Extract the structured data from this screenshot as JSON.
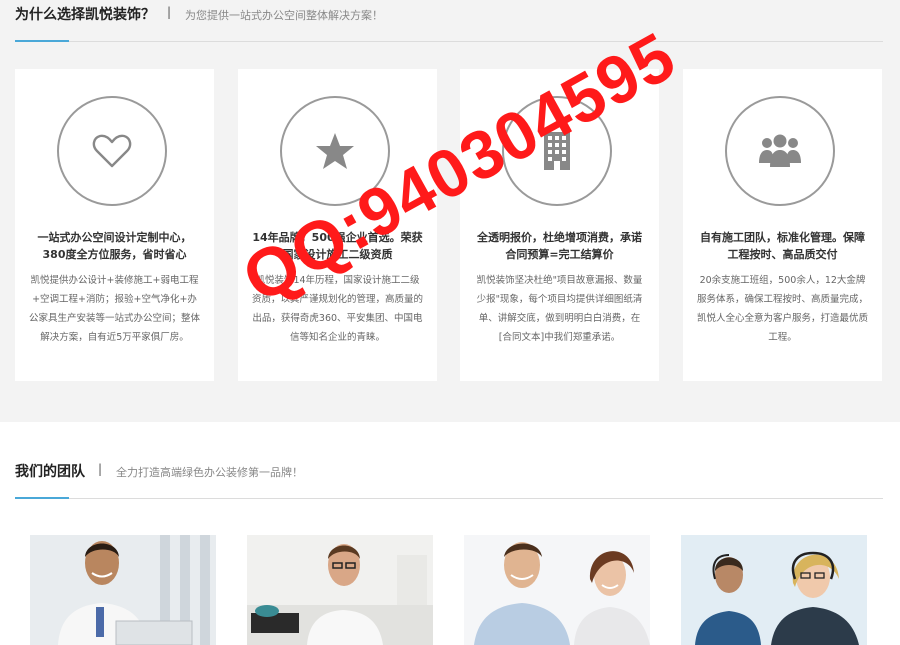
{
  "why": {
    "title": "为什么选择凯悦装饰？",
    "separator": "|",
    "subtitle": "为您提供一站式办公空间整体解决方案！",
    "cards": [
      {
        "icon": "heart-icon",
        "title": "一站式办公空间设计定制中心，380度全方位服务，省时省心",
        "desc": "凯悦提供办公设计+装修施工+弱电工程+空调工程+消防；报验+空气净化+办公家具生产安装等一站式办公空间；整体解决方案，自有近5万平家俱厂房。"
      },
      {
        "icon": "star-icon",
        "title": "14年品牌，500强企业首选。荣获国家设计施工二级资质",
        "desc": "凯悦装饰14年历程，国家设计施工二级资质，以其严谨规划化的管理，高质量的出品，获得奇虎360、平安集团、中国电信等知名企业的青睐。"
      },
      {
        "icon": "building-icon",
        "title": "全透明报价，杜绝增项消费，承诺合同预算=完工结算价",
        "desc": "凯悦装饰坚决杜绝\"项目故意漏报、数量少报\"现象，每个项目均提供详细图纸清单、讲解交底，做到明明白白消费，在[合同文本]中我们郑重承诺。"
      },
      {
        "icon": "team-icon",
        "title": "自有施工团队，标准化管理。保障工程按时、高品质交付",
        "desc": "20余支施工班组，500余人，12大金牌服务体系，确保工程按时、高质量完成，凯悦人全心全意为客户服务，打造最优质工程。"
      }
    ]
  },
  "team": {
    "title": "我们的团队",
    "separator": "|",
    "subtitle": "全力打造高端绿色办公装修第一品牌！",
    "photos": [
      "team-photo-1",
      "team-photo-2",
      "team-photo-3",
      "team-photo-4"
    ]
  },
  "watermark": {
    "text": "QQ:940304595"
  },
  "colors": {
    "accent": "#4aa8d8",
    "watermark": "#ff1a1a",
    "section_bg": "#f3f3f3"
  }
}
